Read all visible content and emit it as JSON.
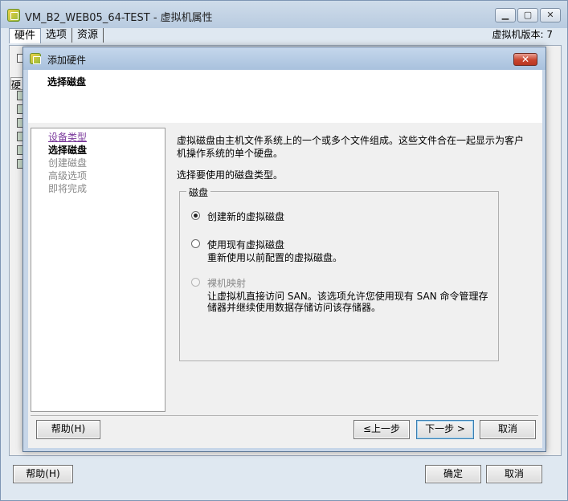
{
  "outer_window": {
    "title": "VM_B2_WEB05_64-TEST - 虚拟机属性",
    "minimize": "▁",
    "maximize": "▢",
    "close": "✕",
    "tabs": [
      {
        "label": "硬件",
        "active": true
      },
      {
        "label": "选项",
        "active": false
      },
      {
        "label": "资源",
        "active": false
      }
    ],
    "vm_version": "虚拟机版本: 7",
    "help_label": "帮助(H)",
    "ok_label": "确定",
    "cancel_label": "取消",
    "hw_header": "硬"
  },
  "dialog": {
    "title": "添加硬件",
    "close": "✕",
    "header_title": "选择磁盘",
    "steps": [
      {
        "label": "设备类型",
        "state": "done"
      },
      {
        "label": "选择磁盘",
        "state": "current"
      },
      {
        "label": "创建磁盘",
        "state": "todo"
      },
      {
        "label": "高级选项",
        "state": "todo"
      },
      {
        "label": "即将完成",
        "state": "todo"
      }
    ],
    "description": "虚拟磁盘由主机文件系统上的一个或多个文件组成。这些文件合在一起显示为客户机操作系统的单个硬盘。",
    "prompt": "选择要使用的磁盘类型。",
    "group_label": "磁盘",
    "options": [
      {
        "label": "创建新的虚拟磁盘",
        "sub": "",
        "selected": true,
        "enabled": true
      },
      {
        "label": "使用现有虚拟磁盘",
        "sub": "重新使用以前配置的虚拟磁盘。",
        "selected": false,
        "enabled": true
      },
      {
        "label": "裸机映射",
        "sub": "让虚拟机直接访问 SAN。该选项允许您使用现有 SAN 命令管理存储器并继续使用数据存储访问该存储器。",
        "selected": false,
        "enabled": false
      }
    ],
    "help_label": "帮助(H)",
    "back_label": "≤上一步",
    "next_label": "下一步 >",
    "cancel_label": "取消"
  }
}
